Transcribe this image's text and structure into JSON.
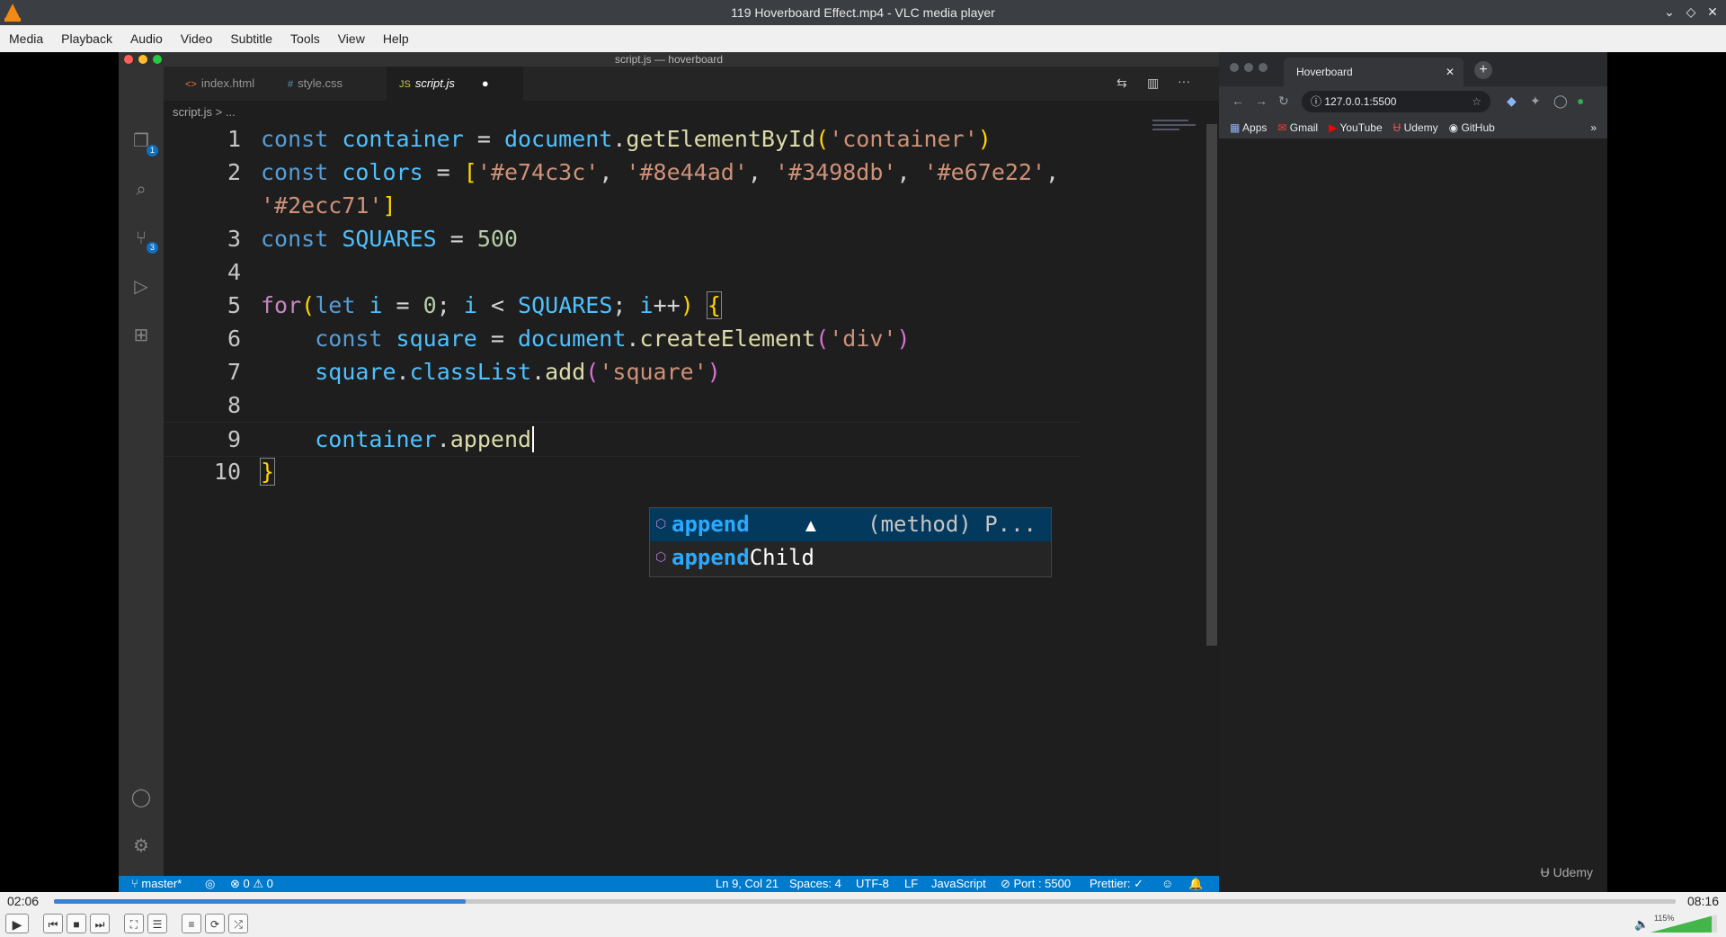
{
  "window": {
    "title": "119 Hoverboard Effect.mp4 - VLC media player",
    "minimize_icon": "chevron-down-icon",
    "maximize_icon": "diamond-icon",
    "close_icon": "close-icon"
  },
  "menu": [
    "Media",
    "Playback",
    "Audio",
    "Video",
    "Subtitle",
    "Tools",
    "View",
    "Help"
  ],
  "vscode": {
    "title": "script.js — hoverboard",
    "tabs": [
      {
        "icon": "<>",
        "label": "index.html"
      },
      {
        "icon": "#",
        "label": "style.css"
      },
      {
        "icon": "JS",
        "label": "script.js"
      }
    ],
    "breadcrumb": "script.js > ...",
    "badges": {
      "explorer": "1",
      "scm": "3"
    },
    "lines": [
      {
        "n": "1",
        "code": "const container = document.getElementById('container')"
      },
      {
        "n": "2",
        "code": "const colors = ['#e74c3c', '#8e44ad', '#3498db', '#e67e22',"
      },
      {
        "n": "",
        "code": "'#2ecc71']"
      },
      {
        "n": "3",
        "code": "const SQUARES = 500"
      },
      {
        "n": "4",
        "code": ""
      },
      {
        "n": "5",
        "code": "for(let i = 0; i < SQUARES; i++) {"
      },
      {
        "n": "6",
        "code": "    const square = document.createElement('div')"
      },
      {
        "n": "7",
        "code": "    square.classList.add('square')"
      },
      {
        "n": "8",
        "code": ""
      },
      {
        "n": "9",
        "code": "    container.append"
      },
      {
        "n": "10",
        "code": "}"
      }
    ],
    "suggestions": [
      {
        "match": "append",
        "rest": "",
        "detail": "(method) P..."
      },
      {
        "match": "append",
        "rest": "Child",
        "detail": ""
      }
    ],
    "status": {
      "branch": "master*",
      "problems": "⊗ 0 ⚠ 0",
      "position": "Ln 9, Col 21",
      "spaces": "Spaces: 4",
      "encoding": "UTF-8",
      "eol": "LF",
      "language": "JavaScript",
      "port": "⊘ Port : 5500",
      "prettier": "Prettier: ✓"
    }
  },
  "browser": {
    "tab_title": "Hoverboard",
    "url": "127.0.0.1:5500",
    "bookmarks": [
      "Apps",
      "Gmail",
      "YouTube",
      "Udemy",
      "GitHub"
    ],
    "watermark": "Udemy"
  },
  "player": {
    "elapsed": "02:06",
    "total": "08:16",
    "progress": 0.254,
    "volume_label": "115%",
    "volume": 1.15
  }
}
